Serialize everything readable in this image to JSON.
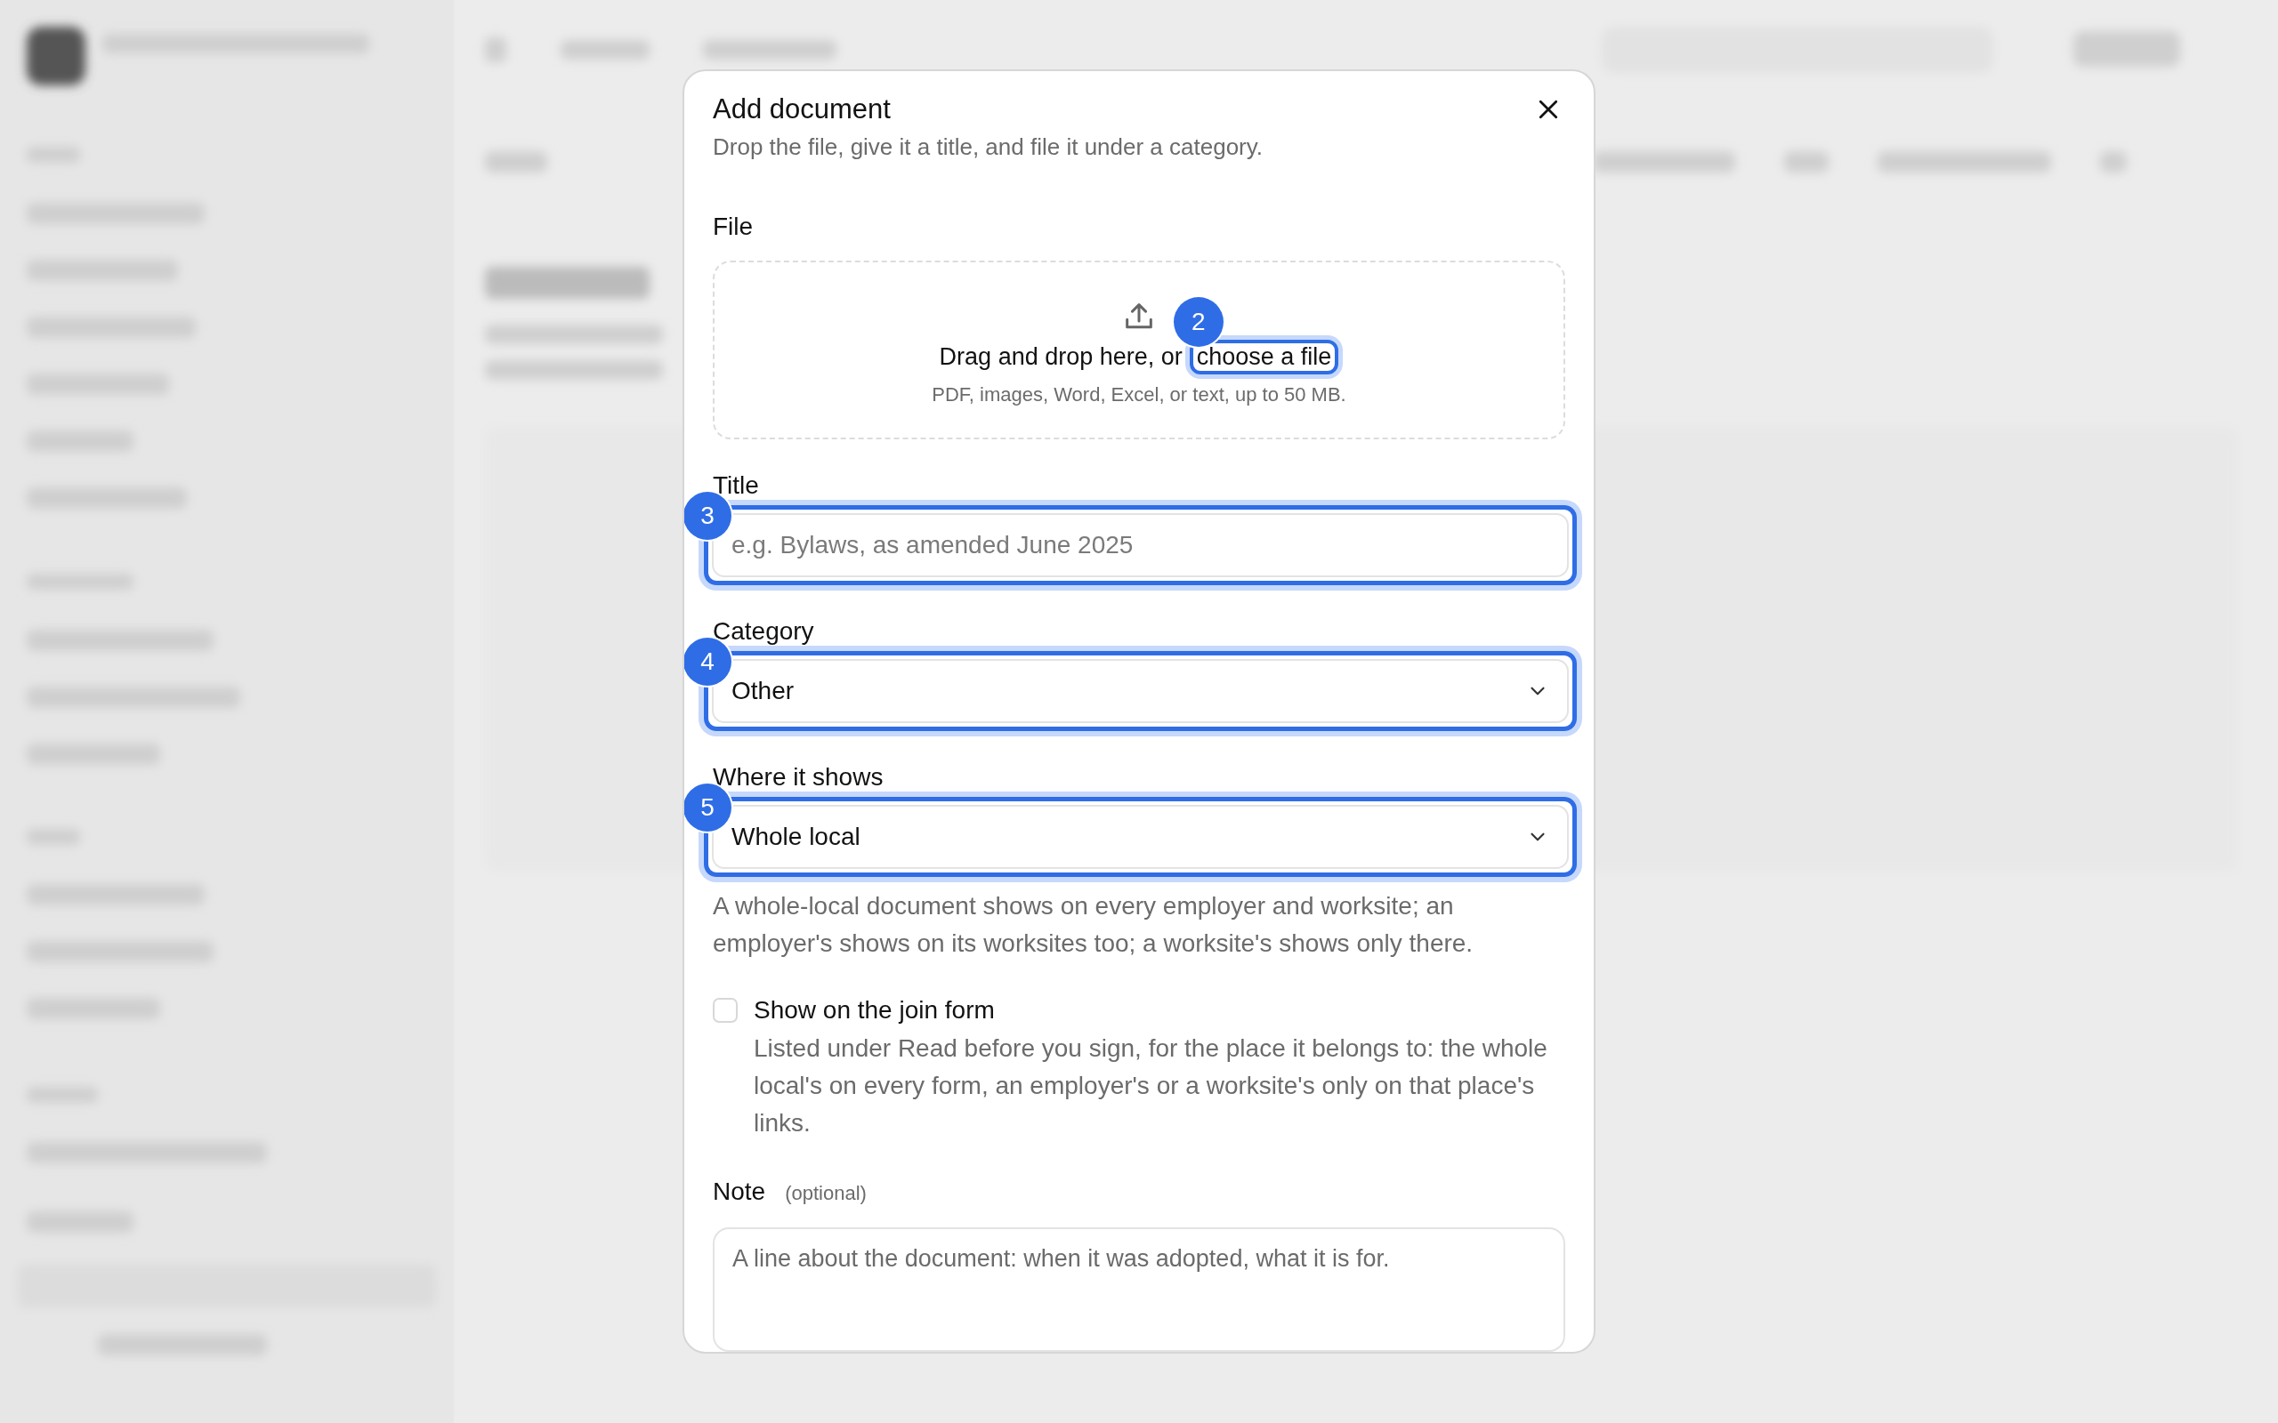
{
  "dialog": {
    "title": "Add document",
    "subtitle": "Drop the file, give it a title, and file it under a category."
  },
  "file": {
    "label": "File",
    "drop_text": "Drag and drop here, or",
    "link": "choose a file",
    "marker": "2",
    "hint": "PDF, images, Word, Excel, or text, up to 50 MB."
  },
  "fields": [
    {
      "kind": "text",
      "label": "Title",
      "placeholder": "e.g. Bylaws, as amended June 2025",
      "marker": "3"
    },
    {
      "kind": "select",
      "label": "Category",
      "value": "Other",
      "marker": "4"
    },
    {
      "kind": "select",
      "label": "Where it shows",
      "value": "Whole local",
      "marker": "5",
      "help": "A whole-local document shows on every employer and worksite; an employer's shows on its worksites too; a worksite's shows only there."
    }
  ],
  "join_form": {
    "label": "Show on the join form",
    "checked": false,
    "description": "Listed under Read before you sign, for the place it belongs to: the whole local's on every form, an employer's or a worksite's only on that place's links."
  },
  "note": {
    "label": "Note",
    "optional": "(optional)",
    "placeholder": "A line about the document: when it was adopted, what it is for."
  }
}
